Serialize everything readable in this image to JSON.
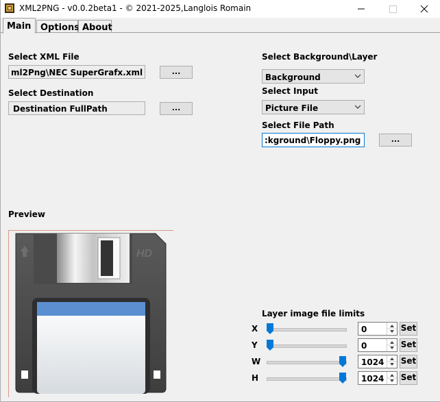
{
  "window": {
    "title": "XML2PNG - v0.0.2beta1 - © 2021-2025,Langlois Romain",
    "minimize_icon": "minimize-icon",
    "maximize_icon": "maximize-icon",
    "close_icon": "close-icon"
  },
  "tabs": [
    {
      "label": "Main",
      "active": true
    },
    {
      "label": "Options",
      "active": false
    },
    {
      "label": "About",
      "active": false
    }
  ],
  "left": {
    "xml_label": "Select XML File",
    "xml_value": "ml2Png\\NEC SuperGrafx.xml",
    "xml_button": "...",
    "dest_label": "Select Destination",
    "dest_value": "Destination FullPath",
    "dest_button": "...",
    "preview_label": "Preview",
    "preview_image": "floppy-disk-icon"
  },
  "right": {
    "bg_layer_label": "Select Background\\Layer",
    "bg_layer_value": "Background",
    "input_label": "Select Input",
    "input_value": "Picture File",
    "filepath_label": "Select File Path",
    "filepath_value": ":kground\\Floppy.png",
    "filepath_button": "..."
  },
  "limits": {
    "title": "Layer image file limits",
    "rows": [
      {
        "label": "X",
        "value": "0",
        "set": "Set",
        "level": 0
      },
      {
        "label": "Y",
        "value": "0",
        "set": "Set",
        "level": 0
      },
      {
        "label": "W",
        "value": "1024",
        "set": "Set",
        "level": 1
      },
      {
        "label": "H",
        "value": "1024",
        "set": "Set",
        "level": 1
      }
    ]
  },
  "colors": {
    "accent": "#0078d7",
    "window_bg": "#f0f0f0",
    "preview_border": "#d89a8a"
  }
}
